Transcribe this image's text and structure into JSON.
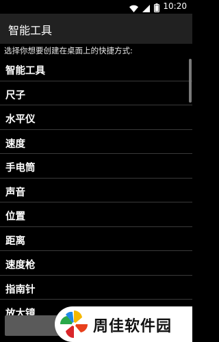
{
  "status_bar": {
    "time": "10:20",
    "icons": [
      "wifi-icon",
      "signal-icon",
      "battery-icon"
    ]
  },
  "app_bar": {
    "title": "智能工具"
  },
  "prompt": "选择你想要创建在桌面上的快捷方式:",
  "list": {
    "items": [
      {
        "label": "智能工具"
      },
      {
        "label": "尺子"
      },
      {
        "label": "水平仪"
      },
      {
        "label": "速度"
      },
      {
        "label": "手电筒"
      },
      {
        "label": "声音"
      },
      {
        "label": "位置"
      },
      {
        "label": "距离"
      },
      {
        "label": "速度枪"
      },
      {
        "label": "指南针"
      },
      {
        "label": "放大镜"
      }
    ]
  },
  "watermark": {
    "text": "周佳软件园"
  },
  "colors": {
    "background": "#000000",
    "app_bar": "#212121",
    "divider": "#3a3a3a",
    "button": "#5a5a5a"
  }
}
